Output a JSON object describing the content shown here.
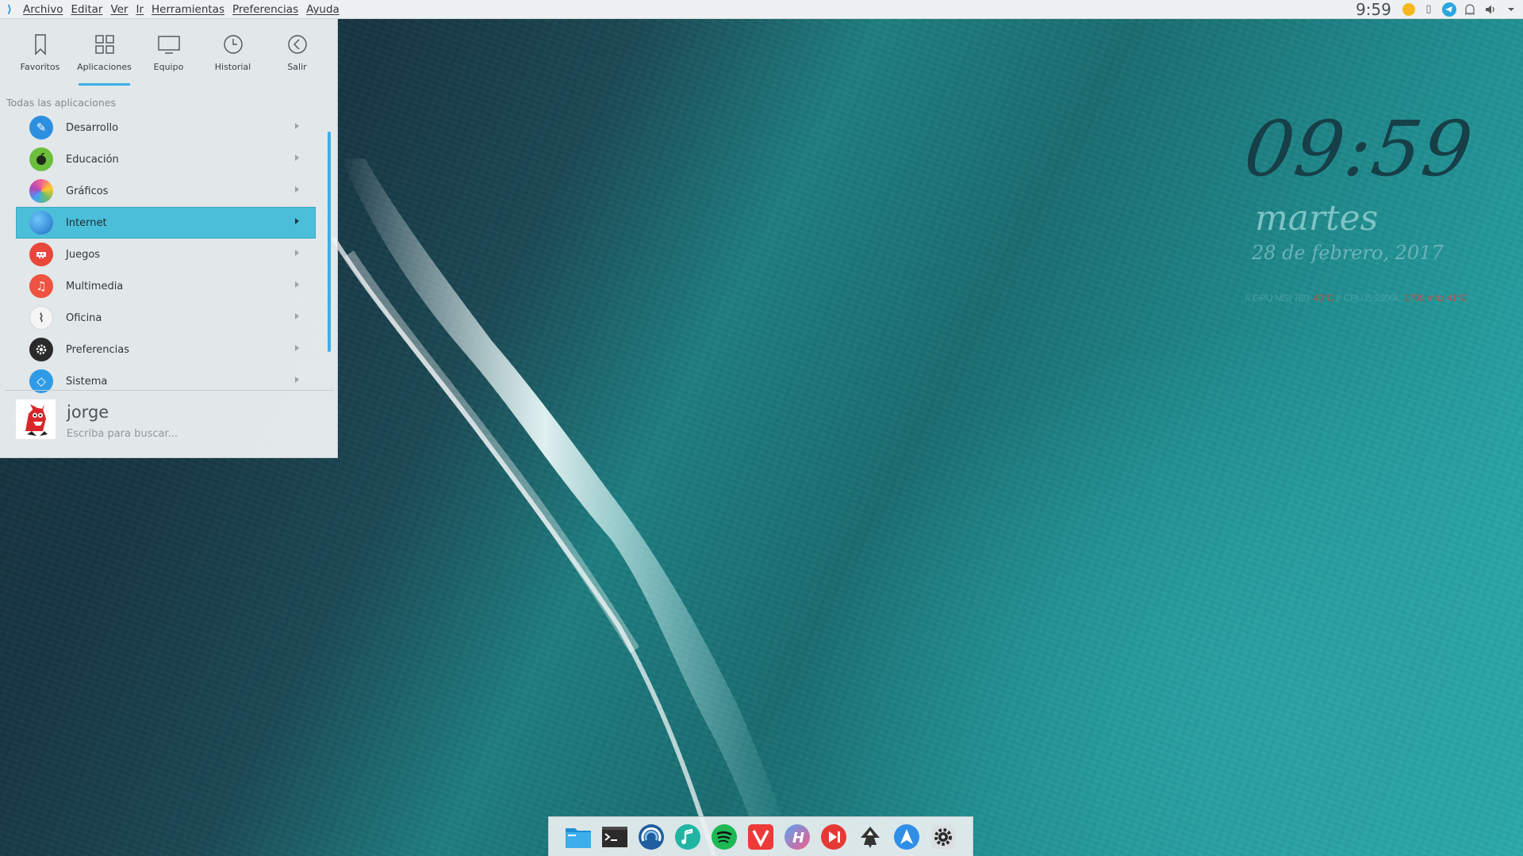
{
  "menubar": {
    "items": [
      "Archivo",
      "Editar",
      "Ver",
      "Ir",
      "Herramientas",
      "Preferencias",
      "Ayuda"
    ],
    "tray": {
      "clock": "9:59",
      "icons": [
        "weather-sun-icon",
        "battery-icon",
        "telegram-icon",
        "ghost-icon",
        "volume-icon",
        "tray-expand-icon"
      ]
    }
  },
  "launcher": {
    "tabs": [
      {
        "label": "Favoritos",
        "icon": "bookmark-icon"
      },
      {
        "label": "Aplicaciones",
        "icon": "grid-icon",
        "active": true
      },
      {
        "label": "Equipo",
        "icon": "monitor-icon"
      },
      {
        "label": "Historial",
        "icon": "clock-icon"
      },
      {
        "label": "Salir",
        "icon": "back-icon"
      }
    ],
    "section_title": "Todas las aplicaciones",
    "categories": [
      {
        "label": "Desarrollo",
        "icon": "development-icon",
        "color": "#2d8fe0"
      },
      {
        "label": "Educación",
        "icon": "education-icon",
        "color": "#6cbf3b"
      },
      {
        "label": "Gráficos",
        "icon": "graphics-icon",
        "color": "#f06292"
      },
      {
        "label": "Internet",
        "icon": "internet-globe-icon",
        "color": "#2b86d3",
        "selected": true
      },
      {
        "label": "Juegos",
        "icon": "games-icon",
        "color": "#e8473a"
      },
      {
        "label": "Multimedia",
        "icon": "multimedia-icon",
        "color": "#ef5241"
      },
      {
        "label": "Oficina",
        "icon": "office-icon",
        "color": "#f5f5f5"
      },
      {
        "label": "Preferencias",
        "icon": "preferences-icon",
        "color": "#2a2a2a"
      },
      {
        "label": "Sistema",
        "icon": "system-icon",
        "color": "#2f9be6"
      }
    ],
    "user": {
      "name": "jorge",
      "search_placeholder": "Escriba para buscar..."
    }
  },
  "widget": {
    "time": "09:59",
    "weekday": "martes",
    "date": "28 de febrero, 2017",
    "sys_prefix": "// GPU MSI 760: ",
    "gpu_temp": "40°C",
    "sys_mid": " // CPU i5 2500k: ",
    "cpu_info": "1700 mhz 41°C",
    "sys_suffix": " //"
  },
  "dock": {
    "apps": [
      {
        "name": "files-icon",
        "color": "#3daee9"
      },
      {
        "name": "terminal-icon",
        "color": "#2b2b2b"
      },
      {
        "name": "browser-icon",
        "color": "#1f5e9e"
      },
      {
        "name": "music-player-icon",
        "color": "#1fb5a3"
      },
      {
        "name": "spotify-icon",
        "color": "#1db954"
      },
      {
        "name": "vivaldi-icon",
        "color": "#ef3939"
      },
      {
        "name": "hexchat-icon",
        "color": "#ea5b87"
      },
      {
        "name": "media-skip-icon",
        "color": "#e53935"
      },
      {
        "name": "inkscape-icon",
        "color": "#333333"
      },
      {
        "name": "navigation-icon",
        "color": "#2f8fe6"
      },
      {
        "name": "settings-gear-icon",
        "color": "#2a2a2a"
      }
    ]
  }
}
